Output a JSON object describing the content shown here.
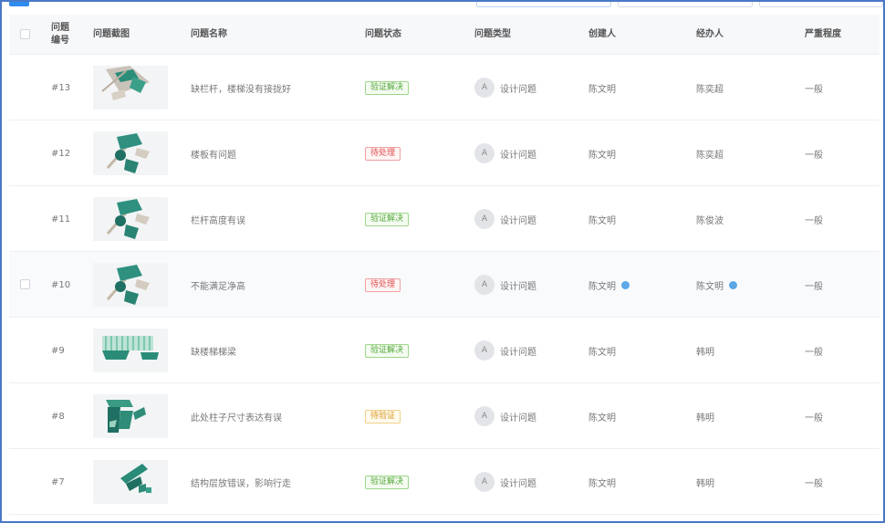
{
  "header": {
    "id": "问题\n编号",
    "screenshot": "问题截图",
    "name": "问题名称",
    "status": "问题状态",
    "type": "问题类型",
    "creator": "创建人",
    "assignee": "经办人",
    "severity": "严重程度"
  },
  "rows": [
    {
      "id": "#13",
      "name": "缺栏杆，楼梯没有接拢好",
      "status": "验证解决",
      "status_color": "green",
      "type_avatar": "A",
      "type": "设计问题",
      "creator": "陈文明",
      "assignee": "陈奕超",
      "severity": "一般",
      "thumb": "a"
    },
    {
      "id": "#12",
      "name": "楼板有问题",
      "status": "待处理",
      "status_color": "red",
      "type_avatar": "A",
      "type": "设计问题",
      "creator": "陈文明",
      "assignee": "陈奕超",
      "severity": "一般",
      "thumb": "b"
    },
    {
      "id": "#11",
      "name": "栏杆高度有误",
      "status": "验证解决",
      "status_color": "green",
      "type_avatar": "A",
      "type": "设计问题",
      "creator": "陈文明",
      "assignee": "陈俊波",
      "severity": "一般",
      "thumb": "b"
    },
    {
      "id": "#10",
      "name": "不能满足净高",
      "status": "待处理",
      "status_color": "red",
      "type_avatar": "A",
      "type": "设计问题",
      "creator": "陈文明",
      "assignee": "陈文明",
      "severity": "一般",
      "thumb": "b"
    },
    {
      "id": "#9",
      "name": "缺楼梯梯梁",
      "status": "验证解决",
      "status_color": "green",
      "type_avatar": "A",
      "type": "设计问题",
      "creator": "陈文明",
      "assignee": "韩明",
      "severity": "一般",
      "thumb": "c"
    },
    {
      "id": "#8",
      "name": "此处柱子尺寸表达有误",
      "status": "待验证",
      "status_color": "yellow",
      "type_avatar": "A",
      "type": "设计问题",
      "creator": "陈文明",
      "assignee": "韩明",
      "severity": "一般",
      "thumb": "d"
    },
    {
      "id": "#7",
      "name": "结构层放错误，影响行走",
      "status": "验证解决",
      "status_color": "green",
      "type_avatar": "A",
      "type": "设计问题",
      "creator": "陈文明",
      "assignee": "韩明",
      "severity": "一般",
      "thumb": "e"
    }
  ],
  "colors": {
    "frame": "#4a78c8",
    "accent": "#2d8cf0",
    "green": "#52a83a",
    "red": "#e05050",
    "yellow": "#d89a20",
    "info": "#5ba8e8"
  }
}
